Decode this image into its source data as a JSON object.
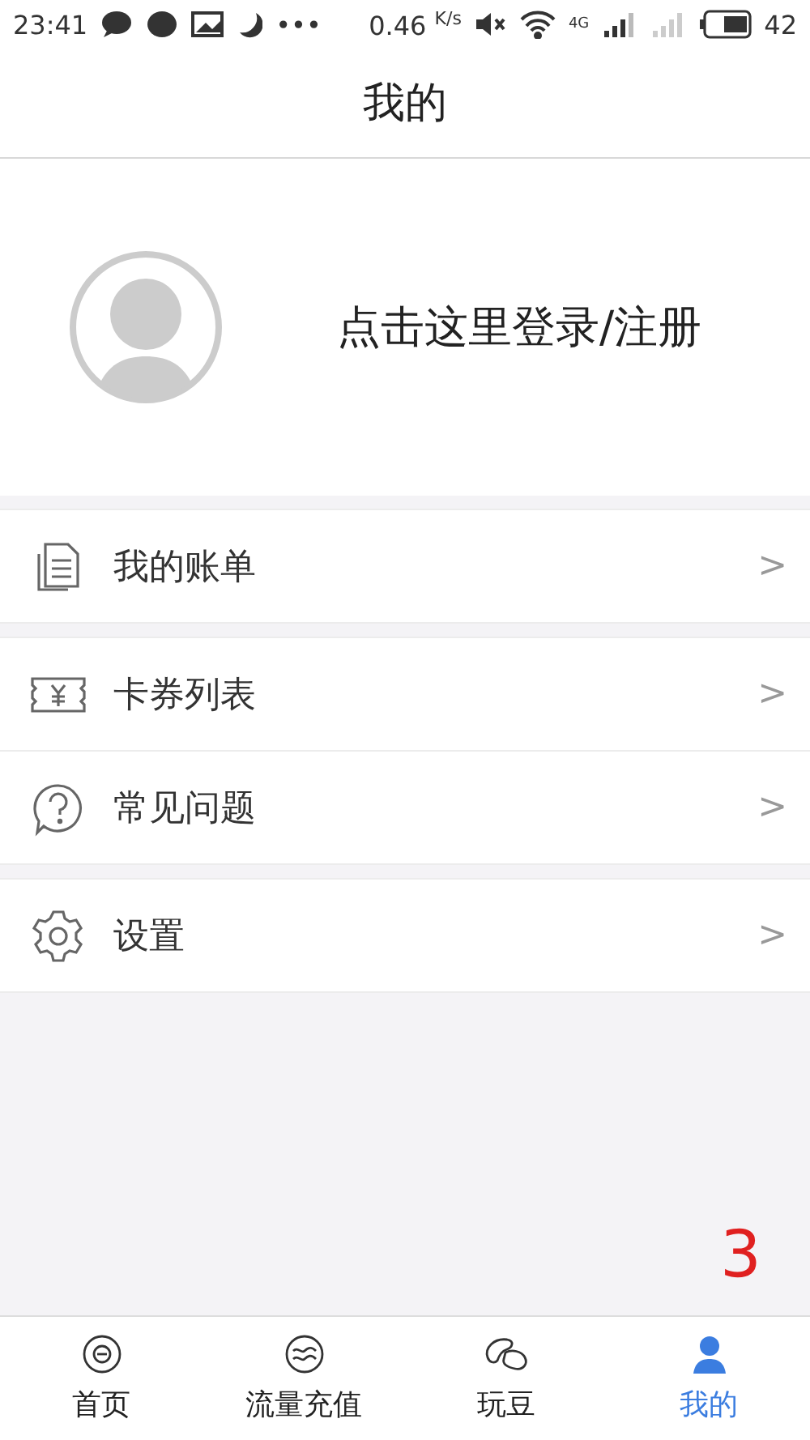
{
  "status_bar": {
    "time": "23:41",
    "dots": "•••",
    "speed": "0.46",
    "speed_unit": "K/s",
    "network": "4G",
    "battery": "42"
  },
  "header": {
    "title": "我的"
  },
  "profile": {
    "login": "点击这里登录/注册"
  },
  "menu_groups": [
    {
      "items": [
        {
          "label": "我的账单",
          "chevron": ">"
        }
      ]
    },
    {
      "items": [
        {
          "label": "卡券列表",
          "chevron": ">"
        },
        {
          "label": "常见问题",
          "chevron": ">"
        }
      ]
    },
    {
      "items": [
        {
          "label": "设置",
          "chevron": ">"
        }
      ]
    }
  ],
  "annotation": "3",
  "tabs": [
    {
      "label": "首页",
      "selected": false
    },
    {
      "label": "流量充值",
      "selected": false
    },
    {
      "label": "玩豆",
      "selected": false
    },
    {
      "label": "我的",
      "selected": true
    }
  ]
}
